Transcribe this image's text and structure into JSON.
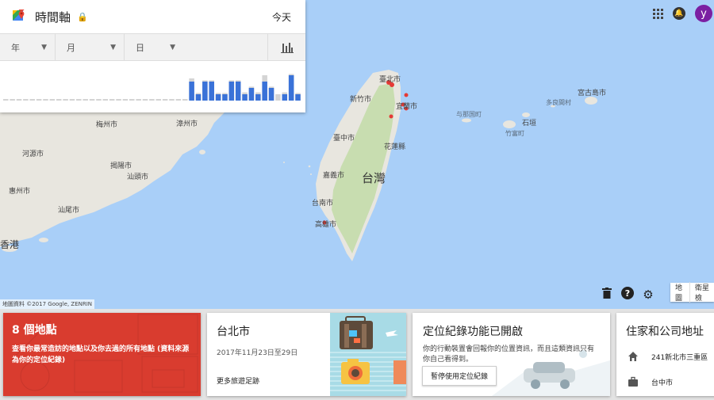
{
  "timeline": {
    "title": "時間軸",
    "today_label": "今天",
    "filters": {
      "year": "年",
      "month": "月",
      "day": "日"
    },
    "histogram_values": [
      0,
      0,
      0,
      0,
      0,
      0,
      0,
      0,
      0,
      0,
      0,
      0,
      0,
      0,
      0,
      0,
      0,
      0,
      0,
      0,
      0,
      0,
      0,
      0,
      0,
      0,
      0,
      0,
      3,
      1,
      3,
      3,
      1,
      1,
      3,
      3,
      1,
      2,
      1,
      3,
      2,
      0,
      1,
      4,
      1
    ],
    "histogram_ghost": [
      0,
      0,
      0,
      0,
      0,
      0,
      0,
      0,
      0,
      0,
      0,
      0,
      0,
      0,
      0,
      0,
      0,
      0,
      0,
      0,
      0,
      0,
      0,
      0,
      0,
      0,
      0,
      0,
      3.5,
      1.2,
      3.2,
      3.2,
      1.2,
      1.2,
      3.2,
      3.2,
      1.3,
      2.2,
      1.3,
      4,
      2.2,
      1,
      1.3,
      4.2,
      1.2
    ],
    "colors": {
      "bar": "#3a72d8",
      "ghost": "#d4d4d4"
    }
  },
  "map": {
    "labels": {
      "taipei": "臺北市",
      "hsinchu": "新竹市",
      "yilan": "宜蘭市",
      "taichung": "臺中市",
      "hualien": "花蓮縣",
      "taiwan": "台灣",
      "chiayi": "嘉義市",
      "tainan": "台南市",
      "kaohsiung": "高雄市",
      "meizhou": "梅州市",
      "zhangzhou": "漳州市",
      "heyuan": "河源市",
      "jieyang": "揭陽市",
      "shantou": "汕頭市",
      "huizhou": "惠州市",
      "shanwei": "汕尾市",
      "hongkong": "香港",
      "yonaguni": "与那国町",
      "ishigaki": "石垣",
      "taketomi": "竹富町",
      "tarama": "多良間村",
      "miyakojima": "宮古島市"
    },
    "attribution": "地圖資料 ©2017 Google, ZENRIN",
    "map_type_buttons": [
      "地圖",
      "衛星檢"
    ]
  },
  "header_right": {
    "avatar_letter": "y"
  },
  "cards": {
    "places": {
      "title": "8 個地點",
      "desc": "查看你最常造訪的地點以及你去過的所有地點 (資料來源為你的定位紀錄)"
    },
    "trip": {
      "title": "台北市",
      "dates": "2017年11月23日至29日",
      "more": "更多旅遊足跡"
    },
    "location": {
      "title": "定位紀錄功能已開啟",
      "desc": "你的行動裝置會回報你的位置資訊，而且這類資訊只有你自己看得到。",
      "button": "暫停使用定位紀錄"
    },
    "home": {
      "title": "住家和公司地址",
      "home_address": "241新北市三重區",
      "work_address": "台中市"
    }
  },
  "colors": {
    "sea": "#a9cff8",
    "land": "#e8e6df",
    "land_green": "#c8ddb0",
    "places_red": "#d93c2f",
    "marker": "#e53935",
    "avatar": "#7b1fa2"
  }
}
